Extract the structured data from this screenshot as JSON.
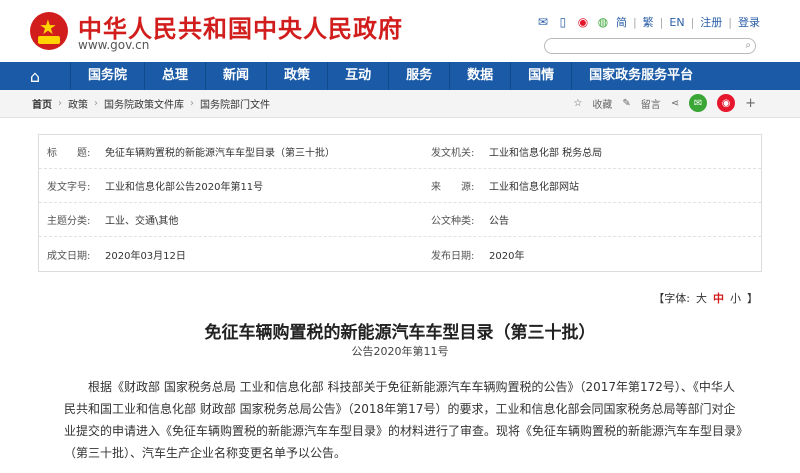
{
  "header": {
    "site_title": "中华人民共和国中央人民政府",
    "site_url": "www.gov.cn",
    "links": [
      "简",
      "繁",
      "EN",
      "注册",
      "登录"
    ],
    "icons": [
      "mail-icon",
      "phone-icon",
      "weibo-icon",
      "wechat-icon"
    ]
  },
  "nav": {
    "items": [
      "国务院",
      "总理",
      "新闻",
      "政策",
      "互动",
      "服务",
      "数据",
      "国情",
      "国家政务服务平台"
    ]
  },
  "breadcrumb": {
    "items": [
      "首页",
      "政策",
      "国务院政策文件库",
      "国务院部门文件"
    ],
    "tools": [
      "收藏",
      "留言"
    ]
  },
  "meta": {
    "rows": [
      {
        "l_label": "标　　题:",
        "l_value": "免征车辆购置税的新能源汽车车型目录（第三十批）",
        "r_label": "发文机关:",
        "r_value": "工业和信息化部 税务总局"
      },
      {
        "l_label": "发文字号:",
        "l_value": "工业和信息化部公告2020年第11号",
        "r_label": "来　　源:",
        "r_value": "工业和信息化部网站"
      },
      {
        "l_label": "主题分类:",
        "l_value": "工业、交通\\其他",
        "r_label": "公文种类:",
        "r_value": "公告"
      },
      {
        "l_label": "成文日期:",
        "l_value": "2020年03月12日",
        "r_label": "发布日期:",
        "r_value": "2020年"
      }
    ]
  },
  "font_size": {
    "prefix": "【字体:",
    "options": [
      "大",
      "中",
      "小"
    ],
    "suffix": "】",
    "active": "中"
  },
  "document": {
    "title": "免征车辆购置税的新能源汽车车型目录（第三十批）",
    "subtitle": "公告2020年第11号",
    "paragraph": "根据《财政部 国家税务总局 工业和信息化部 科技部关于免征新能源汽车车辆购置税的公告》（2017年第172号）、《中华人民共和国工业和信息化部 财政部 国家税务总局公告》（2018年第17号）的要求，工业和信息化部会同国家税务总局等部门对企业提交的申请进入《免征车辆购置税的新能源汽车车型目录》的材料进行了审查。现将《免征车辆购置税的新能源汽车车型目录》（第三十批）、汽车生产企业名称变更名单予以公告。"
  },
  "colors": {
    "brand_red": "#d21d1d",
    "nav_blue": "#1a5aa6"
  }
}
